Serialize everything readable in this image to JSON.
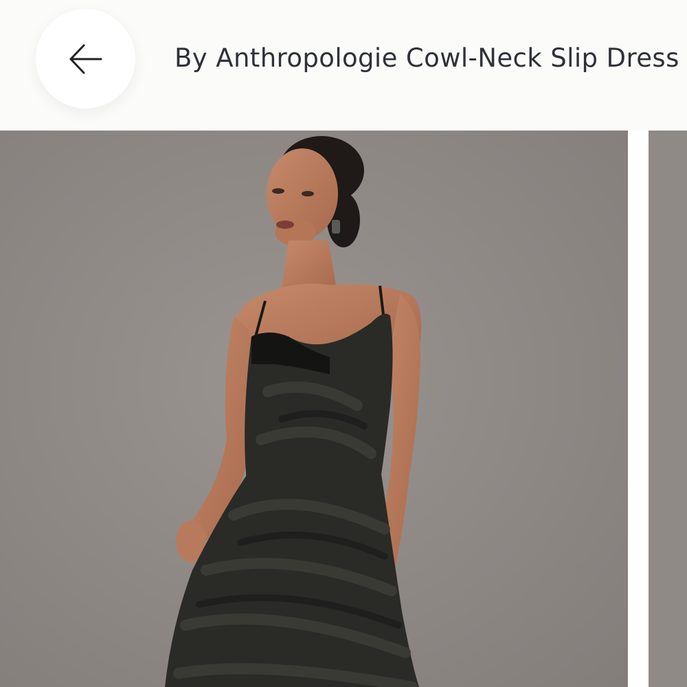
{
  "header": {
    "back_button_icon": "arrow-left-icon",
    "title": "By Anthropologie Cowl-Neck Slip Dress"
  },
  "gallery": {
    "images": [
      {
        "subject": "model in black velvet cowl-neck slip dress"
      },
      {
        "subject": "next product photo (partially visible)"
      }
    ]
  },
  "colors": {
    "header_bg": "#fbfbf9",
    "title_text": "#2f3138",
    "photo_backdrop": "#8e8885",
    "dress": "#2a2a27"
  }
}
